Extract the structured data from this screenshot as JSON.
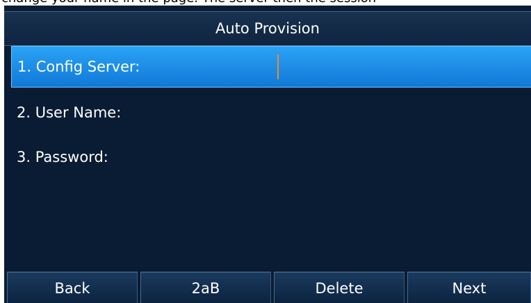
{
  "instruction_fragment": "change your name in the page. The server then the session",
  "title": "Auto Provision",
  "fields": [
    {
      "label": "1. Config Server:",
      "value": ""
    },
    {
      "label": "2. User Name:",
      "value": ""
    },
    {
      "label": "3. Password:",
      "value": ""
    }
  ],
  "selected_field_index": 0,
  "softkeys": [
    {
      "label": "Back"
    },
    {
      "label": "2aB"
    },
    {
      "label": "Delete"
    },
    {
      "label": "Next"
    }
  ],
  "colors": {
    "screen_background": "#0a1c33",
    "selection": "#1a8ee6",
    "cursor": "#f08a2a",
    "text": "#ffffff"
  }
}
